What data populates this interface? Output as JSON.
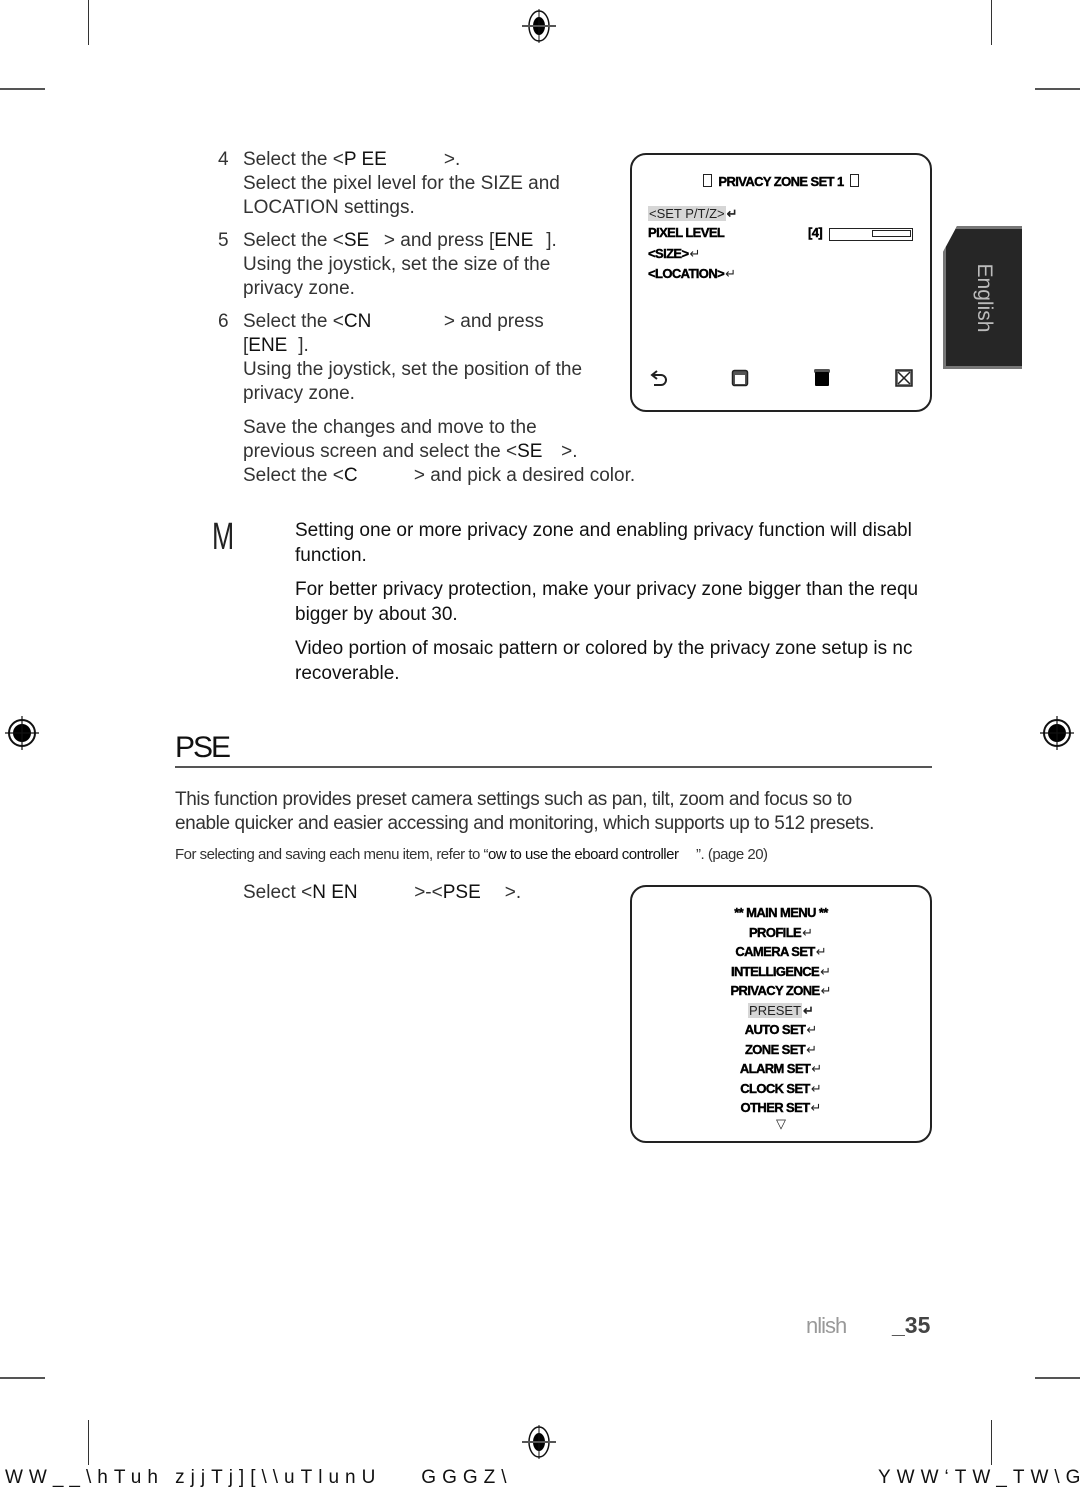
{
  "steps": [
    {
      "num": "4",
      "lines": [
        "Select the <P EE",
        ">.",
        "Select the pixel level for the SIZE and",
        "LOCATION settings."
      ],
      "prefix": "Select the <",
      "bold": "P EE",
      "suffix": ">.",
      "desc": [
        "Select the pixel level for the SIZE and",
        "LOCATION settings."
      ]
    },
    {
      "num": "5",
      "prefix": "Select the <",
      "bold": "SE",
      "mid": "> and press [",
      "bold2": "ENE",
      "suffix": "].",
      "desc": [
        "Using the joystick, set the size of the",
        "privacy zone."
      ]
    },
    {
      "num": "6",
      "prefix": "Select the <",
      "bold": "CN",
      "mid": "> and press",
      "bold2": "ENE",
      "line2_prefix": "[",
      "suffix": "].",
      "desc": [
        "Using the joystick, set the position of the",
        "privacy zone."
      ]
    }
  ],
  "after_steps": {
    "line1": "Save the changes and move to the",
    "line2_prefix": "previous screen and select the <",
    "line2_bold": "SE",
    "line2_suffix": ">.",
    "line3_prefix": "Select the <",
    "line3_bold": "C",
    "line3_suffix": "> and pick a desired color."
  },
  "osd_privacy": {
    "title": "PRIVACY ZONE SET 1",
    "items": [
      {
        "label": "<SET P/T/Z>",
        "highlighted": true
      },
      {
        "label": "PIXEL LEVEL",
        "value": "[4]",
        "level_fraction": 0.5
      },
      {
        "label": "<SIZE>"
      },
      {
        "label": "<LOCATION>"
      }
    ],
    "icons": [
      "return-icon",
      "save-icon",
      "delete-icon",
      "cancel-icon"
    ]
  },
  "language_tab": "English",
  "note_marker": "M",
  "notes": [
    [
      "Setting one or more privacy zone and enabling privacy function will disabl",
      "function."
    ],
    [
      "For better privacy protection, make your privacy zone bigger than the requ",
      "bigger by about 30."
    ],
    [
      "Video portion of mosaic pattern or colored by the privacy zone setup is nc",
      "recoverable."
    ]
  ],
  "section": {
    "title": "PSE",
    "intro": [
      "This function provides preset camera settings such as pan, tilt, zoom and focus so to",
      "enable quicker and easier accessing and monitoring, which supports up to 512 presets."
    ],
    "ref_prefix": "For selecting and saving each menu item, refer to “",
    "ref_bold": "ow to use the eboard controller",
    "ref_suffix": "”. (page 20)",
    "instruction_prefix": "Select <",
    "instruction_bold1": "N EN",
    "instruction_mid": ">-<",
    "instruction_bold2": "PSE",
    "instruction_suffix": ">."
  },
  "osd_main_menu": {
    "title": "** MAIN MENU **",
    "items": [
      {
        "label": "PROFILE",
        "highlighted": false
      },
      {
        "label": "CAMERA SET",
        "highlighted": false
      },
      {
        "label": "INTELLIGENCE",
        "highlighted": false
      },
      {
        "label": "PRIVACY ZONE",
        "highlighted": false
      },
      {
        "label": "PRESET",
        "highlighted": true
      },
      {
        "label": "AUTO SET",
        "highlighted": false
      },
      {
        "label": "ZONE SET",
        "highlighted": false
      },
      {
        "label": "ALARM SET",
        "highlighted": false
      },
      {
        "label": "CLOCK SET",
        "highlighted": false
      },
      {
        "label": "OTHER SET",
        "highlighted": false
      }
    ],
    "more_indicator": "▽"
  },
  "footer": {
    "language": "nlish",
    "page_number": "_35",
    "slug_left": "WW__\\hTuh zjjTj][\\\\uTlunU",
    "slug_left2": "GGGZ\\",
    "slug_right": "YWW‘TW_TW\\GG"
  }
}
